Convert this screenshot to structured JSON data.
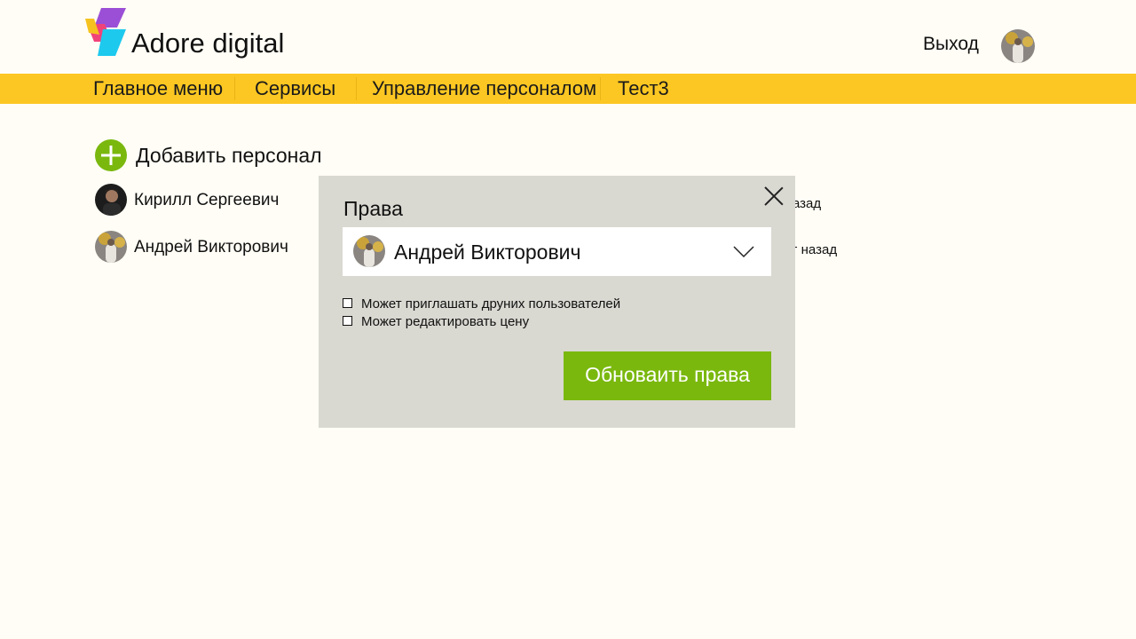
{
  "header": {
    "brand": "Adore digital",
    "logout_label": "Выход",
    "avatar_icon": "user-photo-icon"
  },
  "nav": {
    "items": [
      {
        "label": "Главное меню"
      },
      {
        "label": "Сервисы"
      },
      {
        "label": "Управление персоналом"
      },
      {
        "label": "Тест3"
      }
    ]
  },
  "colors": {
    "background": "#fffdf5",
    "nav_bar": "#fcc722",
    "accent_green": "#7ab80e",
    "modal_bg": "#d9d8d1"
  },
  "staff": {
    "add_label": "Добавить персонал",
    "add_icon": "plus-circle-icon",
    "members": [
      {
        "name": "Кирилл Сергеевич",
        "time": "азад"
      },
      {
        "name": "Андрей Викторович",
        "time": "г назад"
      }
    ]
  },
  "modal": {
    "title": "Права",
    "close_icon": "close-icon",
    "selected_user": "Андрей Викторович",
    "dropdown_icon": "chevron-down-icon",
    "permissions": [
      {
        "label": "Может приглашать друних пользователей",
        "checked": false
      },
      {
        "label": "Может редактировать цену",
        "checked": false
      }
    ],
    "submit_label": "Обноваить права"
  }
}
